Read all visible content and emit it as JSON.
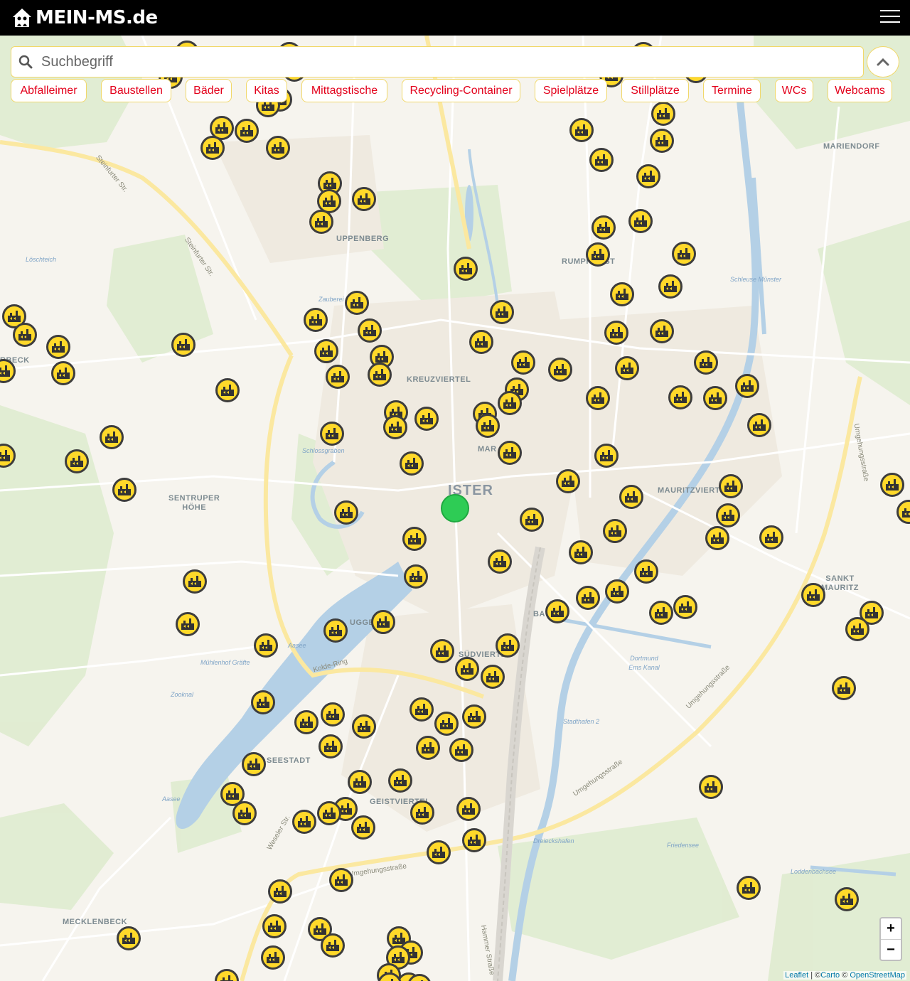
{
  "brand": {
    "name": "MEIN-MS.de"
  },
  "header": {
    "menu_icon": "hamburger-icon"
  },
  "search": {
    "placeholder": "Suchbegriff",
    "value": "",
    "icon": "search-icon"
  },
  "categories": [
    "Abfalleimer",
    "Baustellen",
    "Bäder",
    "Kitas",
    "Mittagstische",
    "Recycling-Container",
    "Spielplätze",
    "Stillplätze",
    "Termine",
    "WCs",
    "Webcams"
  ],
  "colors": {
    "accent": "#e3001b",
    "marker": "#ffd92a",
    "location": "#2ecc55",
    "header": "#000000"
  },
  "map": {
    "district_labels": [
      "UPPENBERG",
      "KREUZVIERTEL",
      "RUMPHORST",
      "MARIENDORF",
      "SENTRUPER\nHÖHE",
      "MAURITZVIERTEL",
      "SANKT\nMAURITZ",
      "SEESTADT",
      "GEISTVIERTEL",
      "MECKLENBECK",
      "SÜDVIERTEL",
      "ISTER",
      "MAR",
      "BA",
      "UGGE",
      "RBECK"
    ],
    "street_labels": [
      "Steinfurter Str.",
      "Steinfurter Str.",
      "Kolde-Ring",
      "Umgehungsstraße",
      "Umgehungsstraße",
      "Umgehungsstraße",
      "Umgehungsstraße",
      "Weseler Str.",
      "Hammer Straße"
    ],
    "water_labels": [
      "Schlossgraben",
      "Aasee",
      "Mühlenhof Gräfte",
      "Zooknal",
      "Aasee",
      "Dortmund Ems Kanal",
      "Stadthafen 2",
      "Dreieckshafen",
      "Friedensee",
      "Loddenbachsee",
      "Schleuse Münster",
      "Löschteich",
      "Zauberei"
    ],
    "marker_icon": "recycling-container-icon",
    "marker_count": 150
  },
  "zoom": {
    "in": "+",
    "out": "−"
  },
  "attribution": {
    "leaflet": "Leaflet",
    "carto": "Carto",
    "osm": "OpenStreetMap",
    "sep1": " | ©",
    "sep2": " © "
  }
}
